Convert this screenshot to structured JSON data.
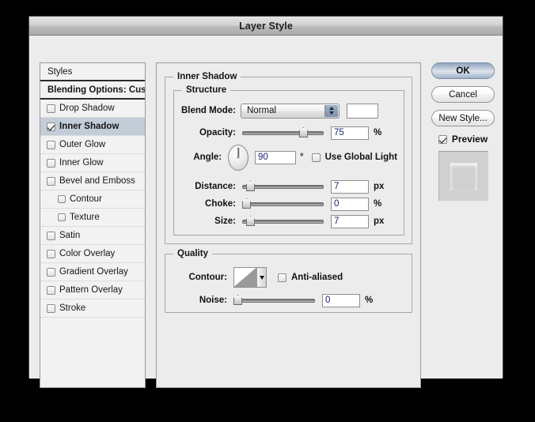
{
  "window": {
    "title": "Layer Style"
  },
  "sidebar": {
    "header": "Styles",
    "blending_options": "Blending Options: Custom",
    "items": [
      {
        "label": "Drop Shadow",
        "checked": false,
        "selected": false,
        "indent": false
      },
      {
        "label": "Inner Shadow",
        "checked": true,
        "selected": true,
        "indent": false
      },
      {
        "label": "Outer Glow",
        "checked": false,
        "selected": false,
        "indent": false
      },
      {
        "label": "Inner Glow",
        "checked": false,
        "selected": false,
        "indent": false
      },
      {
        "label": "Bevel and Emboss",
        "checked": false,
        "selected": false,
        "indent": false
      },
      {
        "label": "Contour",
        "checked": false,
        "selected": false,
        "indent": true
      },
      {
        "label": "Texture",
        "checked": false,
        "selected": false,
        "indent": true
      },
      {
        "label": "Satin",
        "checked": false,
        "selected": false,
        "indent": false
      },
      {
        "label": "Color Overlay",
        "checked": false,
        "selected": false,
        "indent": false
      },
      {
        "label": "Gradient Overlay",
        "checked": false,
        "selected": false,
        "indent": false
      },
      {
        "label": "Pattern Overlay",
        "checked": false,
        "selected": false,
        "indent": false
      },
      {
        "label": "Stroke",
        "checked": false,
        "selected": false,
        "indent": false
      }
    ]
  },
  "main": {
    "group_title": "Inner Shadow",
    "structure": {
      "legend": "Structure",
      "blend_mode_label": "Blend Mode:",
      "blend_mode_value": "Normal",
      "blend_color": "#ffffff",
      "opacity_label": "Opacity:",
      "opacity_value": "75",
      "opacity_unit": "%",
      "angle_label": "Angle:",
      "angle_value": "90",
      "angle_unit": "°",
      "use_global_light_label": "Use Global Light",
      "use_global_light_checked": false,
      "distance_label": "Distance:",
      "distance_value": "7",
      "distance_unit": "px",
      "choke_label": "Choke:",
      "choke_value": "0",
      "choke_unit": "%",
      "size_label": "Size:",
      "size_value": "7",
      "size_unit": "px"
    },
    "quality": {
      "legend": "Quality",
      "contour_label": "Contour:",
      "anti_aliased_label": "Anti-aliased",
      "anti_aliased_checked": false,
      "noise_label": "Noise:",
      "noise_value": "0",
      "noise_unit": "%"
    }
  },
  "buttons": {
    "ok": "OK",
    "cancel": "Cancel",
    "new_style": "New Style...",
    "preview_label": "Preview",
    "preview_checked": true
  }
}
